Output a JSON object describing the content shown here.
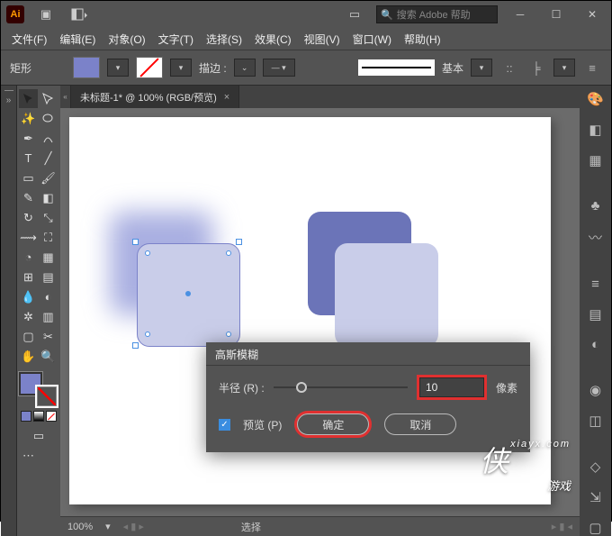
{
  "titlebar": {
    "search_placeholder": "搜索 Adobe 帮助"
  },
  "menubar": {
    "file": "文件(F)",
    "edit": "编辑(E)",
    "object": "对象(O)",
    "type": "文字(T)",
    "select": "选择(S)",
    "effect": "效果(C)",
    "view": "视图(V)",
    "window": "窗口(W)",
    "help": "帮助(H)"
  },
  "ctrlbar": {
    "shape": "矩形",
    "stroke": "描边 :",
    "basic": "基本"
  },
  "tab": {
    "title": "未标题-1* @ 100% (RGB/预览)"
  },
  "dialog": {
    "title": "高斯模糊",
    "radius_label": "半径 (R) :",
    "radius_value": "10",
    "unit": "像素",
    "preview": "预览 (P)",
    "ok": "确定",
    "cancel": "取消"
  },
  "statusbar": {
    "zoom": "100%",
    "mode": "选择"
  },
  "watermark": {
    "big": "侠",
    "site": "xiayx.com",
    "cn": "游戏"
  },
  "colors": {
    "accent": "#7b82c9",
    "light": "#c9cde9",
    "dark": "#6b74b8",
    "highlight": "#e03030",
    "select": "#4a90e2"
  }
}
